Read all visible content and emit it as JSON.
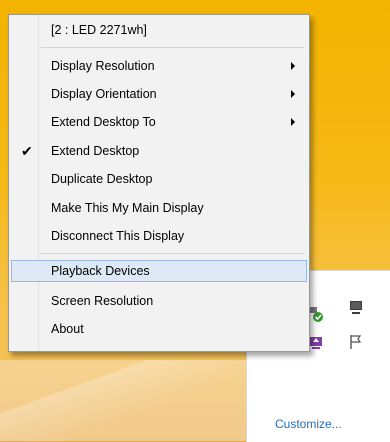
{
  "menu": {
    "header": "[2 : LED 2271wh]",
    "items": [
      {
        "label": "Display Resolution",
        "submenu": true,
        "checked": false
      },
      {
        "label": "Display Orientation",
        "submenu": true,
        "checked": false
      },
      {
        "label": "Extend Desktop To",
        "submenu": true,
        "checked": false
      },
      {
        "label": "Extend Desktop",
        "submenu": false,
        "checked": true
      },
      {
        "label": "Duplicate Desktop",
        "submenu": false,
        "checked": false
      },
      {
        "label": "Make This My Main Display",
        "submenu": false,
        "checked": false
      },
      {
        "label": "Disconnect This Display",
        "submenu": false,
        "checked": false
      }
    ],
    "items2": [
      {
        "label": "Playback Devices",
        "highlighted": true
      },
      {
        "label": "Screen Resolution",
        "highlighted": false
      },
      {
        "label": "About",
        "highlighted": false
      }
    ]
  },
  "tray": {
    "customize_label": "Customize...",
    "icons": [
      "network-ok-icon",
      "display-icon",
      "device-icon",
      "flag-icon"
    ]
  },
  "colors": {
    "accent": "#1f6fbf",
    "highlight_bg": "#dde9f6",
    "highlight_border": "#99b8de",
    "wallpaper": "#f3b300"
  }
}
